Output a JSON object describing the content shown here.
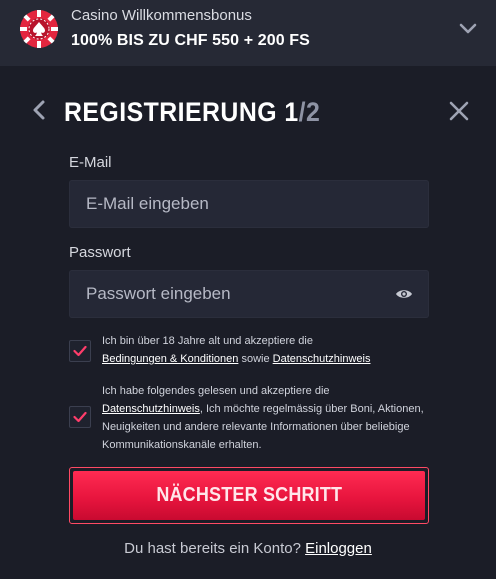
{
  "banner": {
    "subtitle": "Casino Willkommensbonus",
    "offer": "100% BIS ZU CHF 550 + 200 FS",
    "icon": "casino-chip-icon",
    "toggle_icon": "chevron-down-icon"
  },
  "modal": {
    "title_prefix": "REGISTRIERUNG ",
    "step_current": "1",
    "step_separator_total": "/2",
    "back_icon": "chevron-left-icon",
    "close_icon": "close-icon"
  },
  "form": {
    "email": {
      "label": "E-Mail",
      "placeholder": "E-Mail eingeben",
      "value": ""
    },
    "password": {
      "label": "Passwort",
      "placeholder": "Passwort eingeben",
      "value": "",
      "toggle_icon": "eye-icon"
    },
    "consent_terms": {
      "checked": true,
      "text_before": "Ich bin über 18 Jahre alt und akzeptiere die ",
      "link_terms": "Bedingungen & Konditionen",
      "text_middle": " sowie ",
      "link_privacy": "Datenschutzhinweis"
    },
    "consent_marketing": {
      "checked": true,
      "text_before": "Ich habe folgendes gelesen und akzeptiere die ",
      "link_privacy": "Datenschutzhinweis",
      "text_after": ", Ich möchte regelmässig über Boni, Aktionen, Neuigkeiten und andere relevante Informationen über beliebige Kommunikationskanäle erhalten."
    },
    "submit_label": "NÄCHSTER SCHRITT"
  },
  "footer": {
    "question": "Du hast bereits ein Konto? ",
    "login_link": "Einloggen"
  },
  "colors": {
    "background": "#1b1d27",
    "banner_bg": "#262935",
    "input_bg": "#252836",
    "accent": "#e8153e",
    "check": "#ff3d6b"
  }
}
